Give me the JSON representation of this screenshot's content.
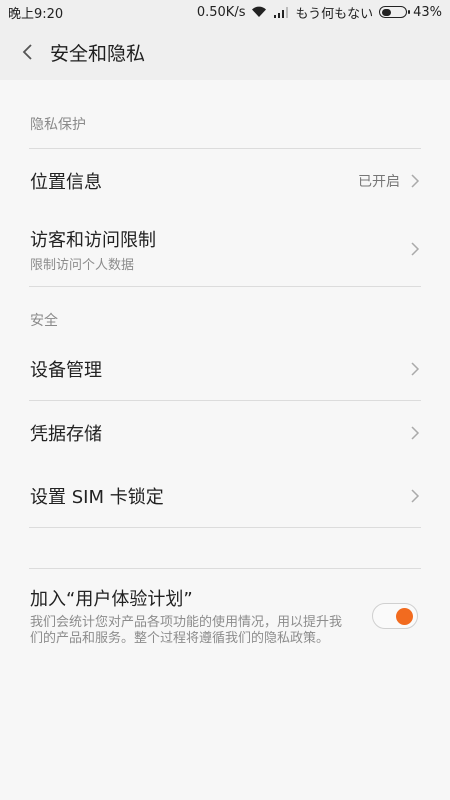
{
  "status": {
    "time": "晚上9:20",
    "speed": "0.50K/s",
    "carrier": "もう何もない",
    "battery": "43%",
    "battery_level": 0.43
  },
  "header": {
    "title": "安全和隐私"
  },
  "privacy": {
    "header": "隐私保护",
    "location": {
      "label": "位置信息",
      "value": "已开启"
    },
    "guest": {
      "label": "访客和访问限制",
      "sub": "限制访问个人数据"
    }
  },
  "security": {
    "header": "安全",
    "device": {
      "label": "设备管理"
    },
    "credentials": {
      "label": "凭据存储"
    },
    "simlock": {
      "label": "设置 SIM 卡锁定"
    }
  },
  "plan": {
    "title": "加入“用户体验计划”",
    "desc": "我们会统计您对产品各项功能的使用情况，用以提升我们的产品和服务。整个过程将遵循我们的隐私政策。",
    "enabled": true,
    "accent": "#f26b1f"
  }
}
